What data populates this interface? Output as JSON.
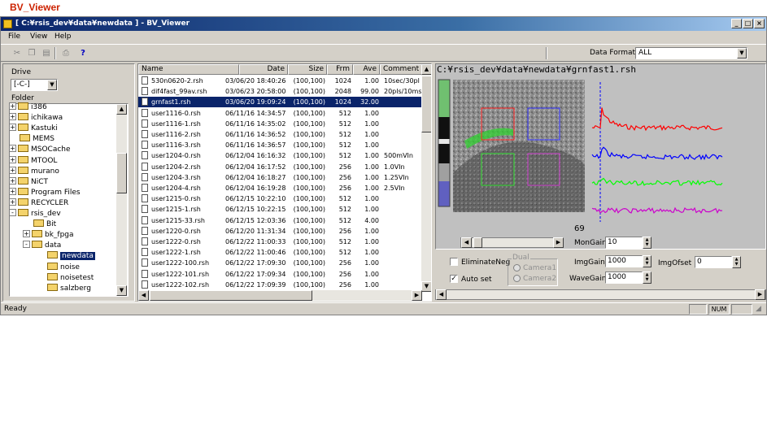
{
  "page_heading": "BV_Viewer",
  "window": {
    "title": "[ C:¥rsis_dev¥data¥newdata ] - BV_Viewer",
    "min_label": "_",
    "max_label": "□",
    "close_label": "×"
  },
  "menu": [
    "File",
    "View",
    "Help"
  ],
  "toolbar": {
    "icons": [
      "cut-icon",
      "copy-icon",
      "paste-icon",
      "print-icon",
      "help-icon"
    ],
    "data_format_label": "Data Format",
    "data_format_value": "ALL"
  },
  "left_panel": {
    "drive_label": "Drive",
    "drive_value": "[-C-]",
    "folder_label": "Folder",
    "tree": [
      {
        "label": "i386",
        "level": 0,
        "expander": "+"
      },
      {
        "label": "ichikawa",
        "level": 0,
        "expander": "+"
      },
      {
        "label": "Kastuki",
        "level": 0,
        "expander": "+"
      },
      {
        "label": "MEMS",
        "level": 0,
        "expander": ""
      },
      {
        "label": "MSOCache",
        "level": 0,
        "expander": "+"
      },
      {
        "label": "MTOOL",
        "level": 0,
        "expander": "+"
      },
      {
        "label": "murano",
        "level": 0,
        "expander": "+"
      },
      {
        "label": "NiCT",
        "level": 0,
        "expander": "+"
      },
      {
        "label": "Program Files",
        "level": 0,
        "expander": "+"
      },
      {
        "label": "RECYCLER",
        "level": 0,
        "expander": "+"
      },
      {
        "label": "rsis_dev",
        "level": 0,
        "expander": "-"
      },
      {
        "label": "Bit",
        "level": 1,
        "expander": ""
      },
      {
        "label": "bk_fpga",
        "level": 1,
        "expander": "+"
      },
      {
        "label": "data",
        "level": 1,
        "expander": "-"
      },
      {
        "label": "newdata",
        "level": 2,
        "expander": "",
        "selected": true
      },
      {
        "label": "noise",
        "level": 2,
        "expander": ""
      },
      {
        "label": "noisetest",
        "level": 2,
        "expander": ""
      },
      {
        "label": "salzberg",
        "level": 2,
        "expander": ""
      }
    ]
  },
  "file_list": {
    "columns": [
      "Name",
      "Date",
      "Size",
      "Frm",
      "Ave",
      "Comment"
    ],
    "rows": [
      [
        "530n0620-2.rsh",
        "03/06/20 18:40:26",
        "(100,100)",
        "1024",
        "1.00",
        "10sec/30pl"
      ],
      [
        "dif4fast_99av.rsh",
        "03/06/23 20:58:00",
        "(100,100)",
        "2048",
        "99.00",
        "20pls/10ms"
      ],
      [
        "grnfast1.rsh",
        "03/06/20 19:09:24",
        "(100,100)",
        "1024",
        "32.00",
        ""
      ],
      [
        "user1116-0.rsh",
        "06/11/16 14:34:57",
        "(100,100)",
        "512",
        "1.00",
        ""
      ],
      [
        "user1116-1.rsh",
        "06/11/16 14:35:02",
        "(100,100)",
        "512",
        "1.00",
        ""
      ],
      [
        "user1116-2.rsh",
        "06/11/16 14:36:52",
        "(100,100)",
        "512",
        "1.00",
        ""
      ],
      [
        "user1116-3.rsh",
        "06/11/16 14:36:57",
        "(100,100)",
        "512",
        "1.00",
        ""
      ],
      [
        "user1204-0.rsh",
        "06/12/04 16:16:32",
        "(100,100)",
        "512",
        "1.00",
        "500mVIn"
      ],
      [
        "user1204-2.rsh",
        "06/12/04 16:17:52",
        "(100,100)",
        "256",
        "1.00",
        "1.0VIn"
      ],
      [
        "user1204-3.rsh",
        "06/12/04 16:18:27",
        "(100,100)",
        "256",
        "1.00",
        "1.25VIn"
      ],
      [
        "user1204-4.rsh",
        "06/12/04 16:19:28",
        "(100,100)",
        "256",
        "1.00",
        "2.5VIn"
      ],
      [
        "user1215-0.rsh",
        "06/12/15 10:22:10",
        "(100,100)",
        "512",
        "1.00",
        ""
      ],
      [
        "user1215-1.rsh",
        "06/12/15 10:22:15",
        "(100,100)",
        "512",
        "1.00",
        ""
      ],
      [
        "user1215-33.rsh",
        "06/12/15 12:03:36",
        "(100,100)",
        "512",
        "4.00",
        ""
      ],
      [
        "user1220-0.rsh",
        "06/12/20 11:31:34",
        "(100,100)",
        "256",
        "1.00",
        ""
      ],
      [
        "user1222-0.rsh",
        "06/12/22 11:00:33",
        "(100,100)",
        "512",
        "1.00",
        ""
      ],
      [
        "user1222-1.rsh",
        "06/12/22 11:00:46",
        "(100,100)",
        "512",
        "1.00",
        ""
      ],
      [
        "user1222-100.rsh",
        "06/12/22 17:09:30",
        "(100,100)",
        "256",
        "1.00",
        ""
      ],
      [
        "user1222-101.rsh",
        "06/12/22 17:09:34",
        "(100,100)",
        "256",
        "1.00",
        ""
      ],
      [
        "user1222-102.rsh",
        "06/12/22 17:09:39",
        "(100,100)",
        "256",
        "1.00",
        ""
      ]
    ],
    "selected_index": 2
  },
  "viewer": {
    "path_label": "C:¥rsis_dev¥data¥newdata¥grnfast1.rsh",
    "frame_number": "69",
    "trace_colors": [
      "#ff0000",
      "#0000ff",
      "#00ff00",
      "#cc00cc"
    ]
  },
  "controls": {
    "mon_gain_label": "MonGain",
    "mon_gain_value": "10",
    "img_gain_label": "ImgGain",
    "img_gain_value": "1000",
    "img_ofset_label": "ImgOfset",
    "img_ofset_value": "0",
    "wave_gain_label": "WaveGain",
    "wave_gain_value": "1000",
    "eliminate_neg_label": "EliminateNeg",
    "auto_set_label": "Auto set",
    "auto_set_checked": "✓",
    "dual_label": "Dual",
    "camera1_label": "Camera1",
    "camera2_label": "Camera2"
  },
  "status": {
    "text": "Ready",
    "num": "NUM"
  }
}
